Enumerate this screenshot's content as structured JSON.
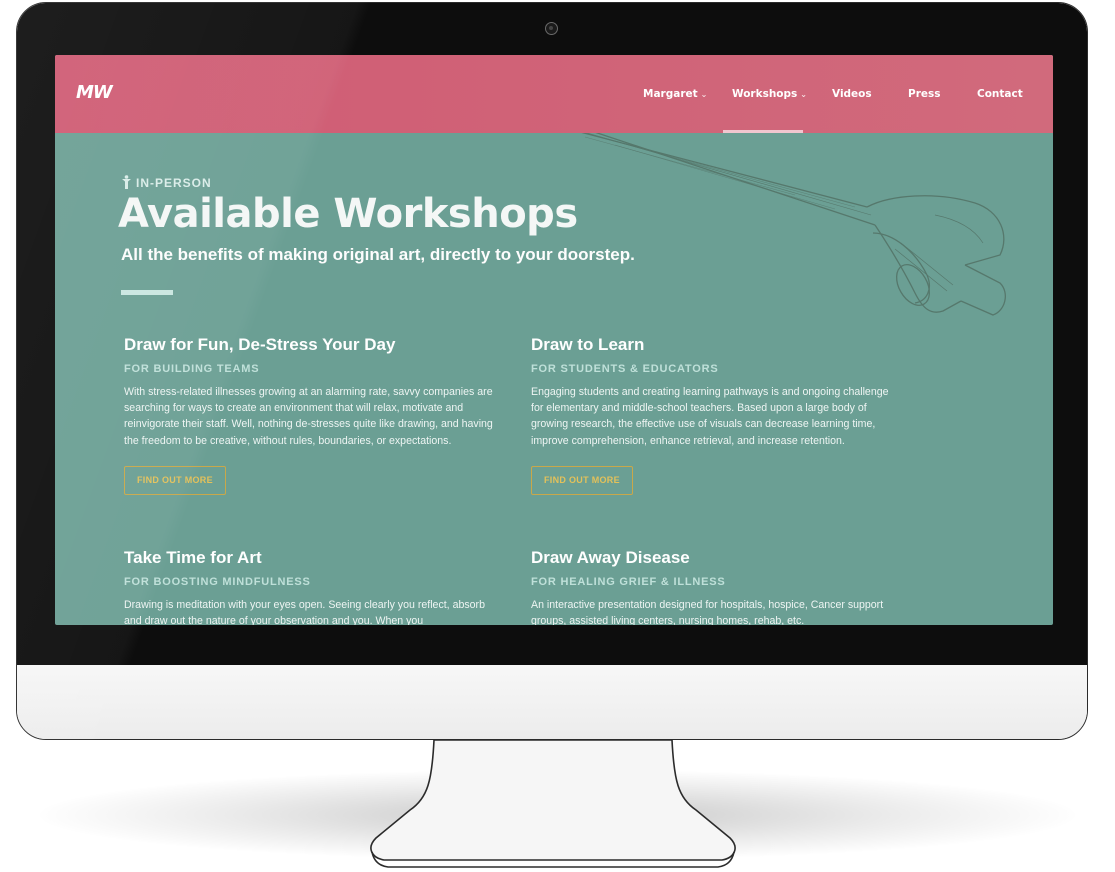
{
  "nav": {
    "logo": "MW",
    "items": [
      {
        "label": "Margaret",
        "has_dropdown": true
      },
      {
        "label": "Workshops",
        "has_dropdown": true,
        "active": true
      },
      {
        "label": "Videos",
        "has_dropdown": false
      },
      {
        "label": "Press",
        "has_dropdown": false
      },
      {
        "label": "Contact",
        "has_dropdown": false
      }
    ]
  },
  "hero": {
    "eyebrow": "IN-PERSON",
    "eyebrow_icon": "person-icon",
    "title": "Available Workshops",
    "subtitle": "All the benefits of making original art, directly to your doorstep.",
    "illustration": "wrench-sketch"
  },
  "cards": [
    {
      "title": "Draw for Fun, De-Stress Your Day",
      "tag": "FOR BUILDING TEAMS",
      "body": "With stress-related illnesses growing at an alarming rate, savvy companies are searching for ways to create an environment that will relax, motivate and reinvigorate their staff. Well, nothing de-stresses quite like drawing, and having the freedom to be creative, without rules, boundaries, or expectations.",
      "button": "FIND OUT MORE"
    },
    {
      "title": "Draw to Learn",
      "tag": "FOR STUDENTS & EDUCATORS",
      "body": "Engaging students and creating learning pathways is and ongoing challenge for elementary and middle-school teachers. Based upon a large body of growing research, the effective use of visuals can decrease learning time, improve comprehension, enhance retrieval, and increase retention.",
      "button": "FIND OUT MORE"
    },
    {
      "title": "Take Time for Art",
      "tag": "FOR BOOSTING MINDFULNESS",
      "body": "Drawing is meditation with your eyes open. Seeing clearly you reflect, absorb and draw out the nature of your observation and you. When you"
    },
    {
      "title": "Draw Away Disease",
      "tag": "FOR HEALING GRIEF & ILLNESS",
      "body": "An interactive presentation designed for hospitals, hospice, Cancer support groups, assisted living centers, nursing homes, rehab, etc."
    }
  ],
  "colors": {
    "nav_bg": "#cf5b73",
    "page_bg": "#6b9f94",
    "button_accent": "#e3c15a",
    "tag_color": "#bfe0d9"
  }
}
